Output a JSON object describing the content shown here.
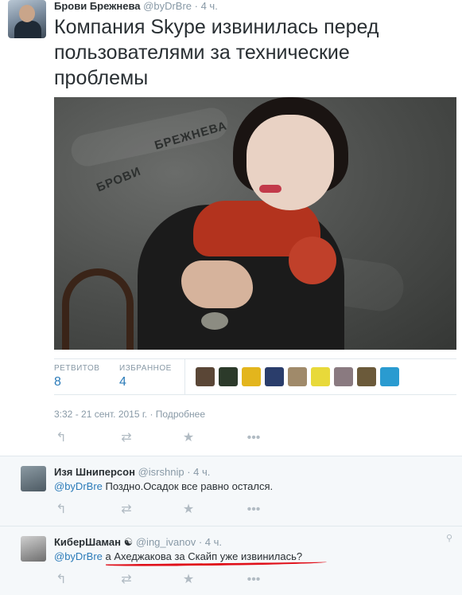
{
  "main_tweet": {
    "fullname": "Брови Брежнева",
    "handle": "@byDrBre",
    "time": "· 4 ч.",
    "text": "Компания Skype извинилась перед пользователями за технические проблемы",
    "photo": {
      "stamp_text_1": "БРОВИ",
      "stamp_text_2": "БРЕЖНЕВА"
    },
    "stats": {
      "retweets_label": "РЕТВИТОВ",
      "retweets_value": "8",
      "favorites_label": "ИЗБРАННОЕ",
      "favorites_value": "4"
    },
    "timestamp": "3:32 - 21 сент. 2015 г. · Подробнее"
  },
  "replies": [
    {
      "fullname": "Изя Шниперсон",
      "handle": "@isrshnip",
      "time": "· 4 ч.",
      "mention": "@byDrBre",
      "text": " Поздно.Осадок все равно остался."
    },
    {
      "fullname": "КиберШаман",
      "badge": "☯",
      "handle": "@ing_ivanov",
      "time": "· 4 ч.",
      "mention": "@byDrBre",
      "text": " а Ахеджакова за Скайп уже извинилась?"
    }
  ],
  "icons": {
    "reply": "reply-icon",
    "retweet": "retweet-icon",
    "favorite": "star-icon",
    "more": "more-icon",
    "geo": "location-pin-icon"
  },
  "colors": {
    "link": "#2b7bb9",
    "muted": "#8899a6",
    "action": "#b1bbc3",
    "annotation": "#e0101a"
  }
}
